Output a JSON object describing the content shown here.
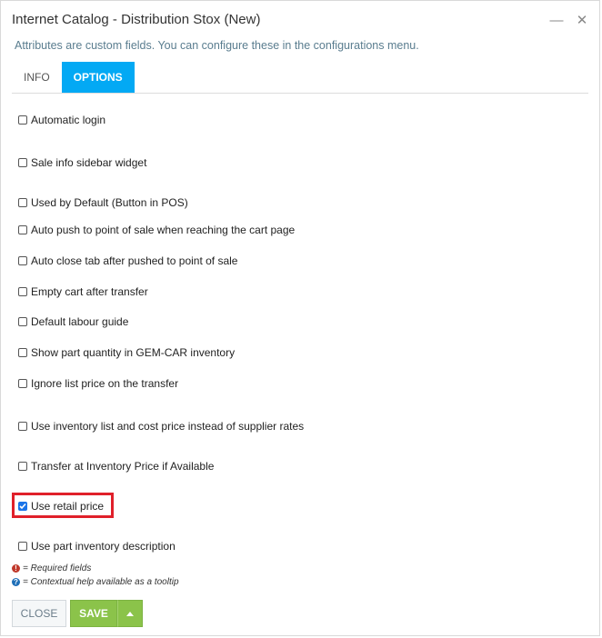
{
  "dialog": {
    "title": "Internet Catalog - Distribution Stox (New)",
    "minimize_glyph": "—",
    "close_glyph": "✕",
    "subtitle": "Attributes are custom fields. You can configure these in the configurations menu."
  },
  "tabs": [
    {
      "label": "INFO",
      "active": false
    },
    {
      "label": "OPTIONS",
      "active": true
    }
  ],
  "options": [
    {
      "label": "Automatic login",
      "checked": false
    },
    {
      "label": "Sale info sidebar widget",
      "checked": false
    },
    {
      "label": "Used by Default (Button in POS)",
      "checked": false
    },
    {
      "label": "Auto push to point of sale when reaching the cart page",
      "checked": false
    },
    {
      "label": "Auto close tab after pushed to point of sale",
      "checked": false
    },
    {
      "label": "Empty cart after transfer",
      "checked": false
    },
    {
      "label": "Default labour guide",
      "checked": false
    },
    {
      "label": "Show part quantity in GEM-CAR inventory",
      "checked": false
    },
    {
      "label": "Ignore list price on the transfer",
      "checked": false
    },
    {
      "label": "Use inventory list and cost price instead of supplier rates",
      "checked": false
    },
    {
      "label": "Transfer at Inventory Price if Available",
      "checked": false
    },
    {
      "label": "Use retail price",
      "checked": true
    },
    {
      "label": "Use part inventory description",
      "checked": false
    }
  ],
  "legend": {
    "required_icon": "!",
    "required_text": "= Required fields",
    "help_icon": "?",
    "help_text": "= Contextual help available as a tooltip"
  },
  "footer": {
    "close_label": "CLOSE",
    "save_label": "SAVE"
  },
  "colors": {
    "accent": "#03a9f4",
    "save": "#8bc34a",
    "highlight": "#e0202a",
    "required": "#c0392b",
    "help": "#1e6fb8"
  }
}
